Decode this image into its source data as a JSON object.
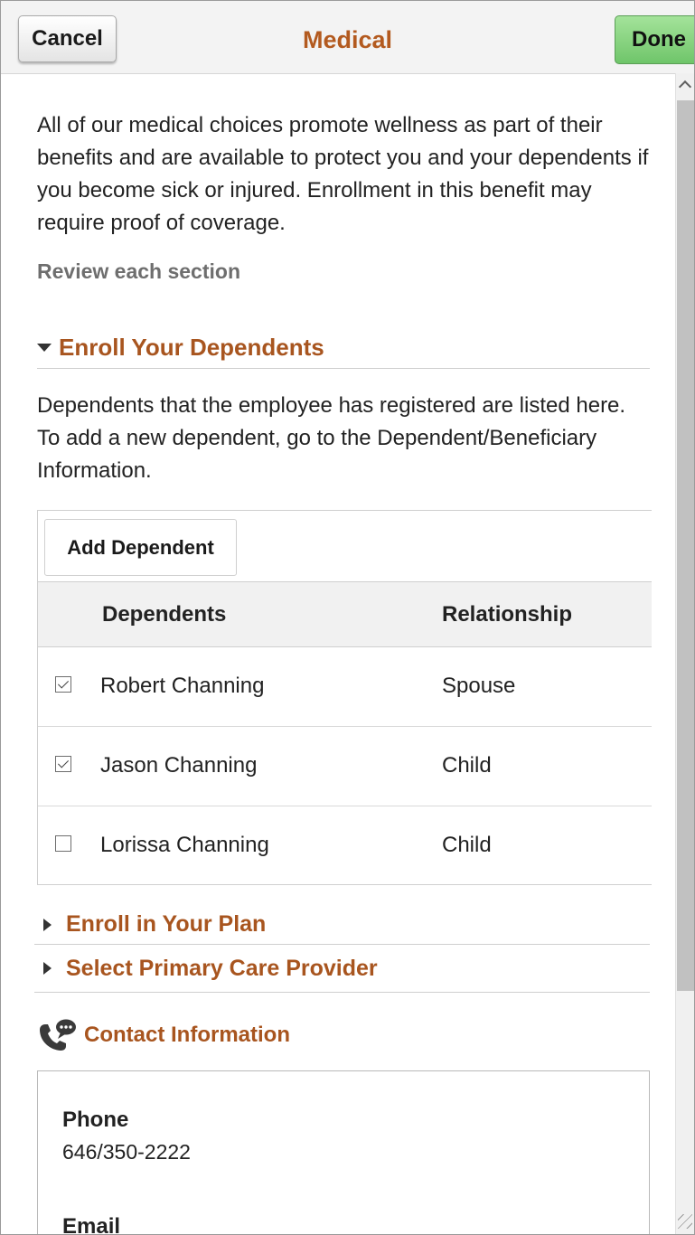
{
  "header": {
    "cancel_label": "Cancel",
    "title": "Medical",
    "done_label": "Done"
  },
  "intro": "All of our medical choices promote wellness as part of their benefits and are available to protect you and your dependents if you become sick or injured. Enrollment in this benefit may require proof of coverage.",
  "review_label": "Review each section",
  "sections": {
    "enroll_dependents": "Enroll Your Dependents",
    "enroll_plan": "Enroll in Your Plan",
    "primary_care": "Select Primary Care Provider"
  },
  "dependents_text": "Dependents that the employee has registered are listed here. To add a new dependent, go to the Dependent/Beneficiary Information.",
  "grid": {
    "add_label": "Add Dependent",
    "columns": [
      "Dependents",
      "Relationship"
    ],
    "rows": [
      {
        "name": "Robert Channing",
        "relationship": "Spouse",
        "checked": true
      },
      {
        "name": "Jason Channing",
        "relationship": "Child",
        "checked": true
      },
      {
        "name": "Lorissa Channing",
        "relationship": "Child",
        "checked": false
      }
    ]
  },
  "contact": {
    "title": "Contact Information",
    "phone_label": "Phone",
    "phone_value": "646/350-2222",
    "email_label": "Email"
  },
  "colors": {
    "accent": "#a8551f",
    "done_button": "#6fc56a"
  },
  "icons": [
    "chevron-up-icon",
    "triangle-down-icon",
    "triangle-right-icon",
    "phone-chat-icon",
    "checkbox-icon",
    "resize-grip-icon"
  ]
}
